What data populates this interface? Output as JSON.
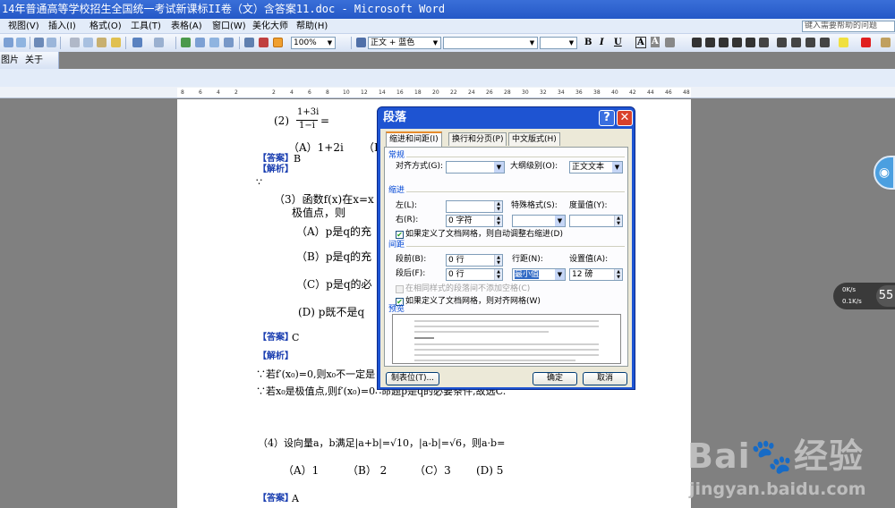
{
  "window": {
    "title": "14年普通高等学校招生全国统一考试新课标II卷（文）含答案11.doc - Microsoft Word"
  },
  "menu": {
    "items": [
      "视图(V)",
      "插入(I)",
      "格式(O)",
      "工具(T)",
      "表格(A)",
      "窗口(W)",
      "美化大师",
      "帮助(H)"
    ],
    "help_search": "键入需要帮助的问题"
  },
  "toolbar": {
    "zoom": "100%",
    "style": "正文 + 蓝色",
    "format_buttons": [
      "B",
      "I",
      "U",
      "A",
      "A"
    ],
    "row2_items": [
      "图片",
      "关于"
    ]
  },
  "ruler": {
    "ticks": [
      "8",
      "6",
      "4",
      "2",
      "",
      "2",
      "4",
      "6",
      "8",
      "10",
      "12",
      "14",
      "16",
      "18",
      "20",
      "22",
      "24",
      "26",
      "28",
      "30",
      "32",
      "34",
      "36",
      "38",
      "40",
      "42",
      "44",
      "46",
      "48"
    ]
  },
  "document": {
    "q2": "(2)",
    "q2_fraction_num": "1+3i",
    "q2_fraction_den": "1−i",
    "q2_eq": "=",
    "q2_optA": "（A）1+2i",
    "q2_optB": "（B",
    "ans_B_label": "【答案】",
    "ans_B_value": "B",
    "jiexi1": "【解析】",
    "jiexi1_formula": "∵",
    "q3_line1": "（3）函数f(x)在x=x",
    "q3_line2": "极值点，则",
    "q3_optA": "（A）p是q的充",
    "q3_optB": "（B）p是q的充",
    "q3_optC": "（C）p是q的必",
    "q3_optD": "(D)  p既不是q",
    "ans_C_label": "【答案】",
    "ans_C_value": "C",
    "jiexi2": "【解析】",
    "reason1": "∵若f′(x₀)=0,则x₀不一定是",
    "reason2": "∵若x₀是极值点,则f′(x₀)=0∴命题p是q的必要条件,故选C.",
    "q4": "（4）设向量a，b满足|a+b|=√10，|a-b|=√6，则a·b=",
    "q4_opts": [
      "（A）1",
      "（B） 2",
      "（C）3",
      "(D) 5"
    ],
    "ans_A_label": "【答案】",
    "ans_A_value": "A"
  },
  "dialog": {
    "title": "段落",
    "tabs": [
      "缩进和间距(I)",
      "换行和分页(P)",
      "中文版式(H)"
    ],
    "general_label": "常规",
    "align_label": "对齐方式(G):",
    "align_value": "",
    "outline_label": "大纲级别(O):",
    "outline_value": "正文文本",
    "indent_label": "缩进",
    "left_label": "左(L):",
    "left_value": "",
    "right_label": "右(R):",
    "right_value": "0 字符",
    "special_label": "特殊格式(S):",
    "special_value": "",
    "measure_label": "度量值(Y):",
    "measure_value": "",
    "grid_indent_label": "如果定义了文档网格，则自动调整右缩进(D)",
    "spacing_label": "间距",
    "before_label": "段前(B):",
    "before_value": "0 行",
    "after_label": "段后(F):",
    "after_value": "0 行",
    "line_label": "行距(N):",
    "line_value": "最小值",
    "setting_label": "设置值(A):",
    "setting_value": "12 磅",
    "no_space_label": "在相同样式的段落间不添加空格(C)",
    "snap_grid_label": "如果定义了文档网格，则对齐网格(W)",
    "preview_label": "预览",
    "tabs_button": "制表位(T)...",
    "ok_button": "确定",
    "cancel_button": "取消"
  },
  "overlay": {
    "net_up": "0K/s",
    "net_down": "0.1K/s",
    "net_num": "55",
    "watermark_logo": "Bai🐾经验",
    "watermark_url": "jingyan.baidu.com"
  },
  "colors": {
    "title_bar": "#2458c7",
    "dialog_frame": "#1e54d2",
    "answer_text": "#1a3eb0",
    "close_button": "#d9422b"
  }
}
